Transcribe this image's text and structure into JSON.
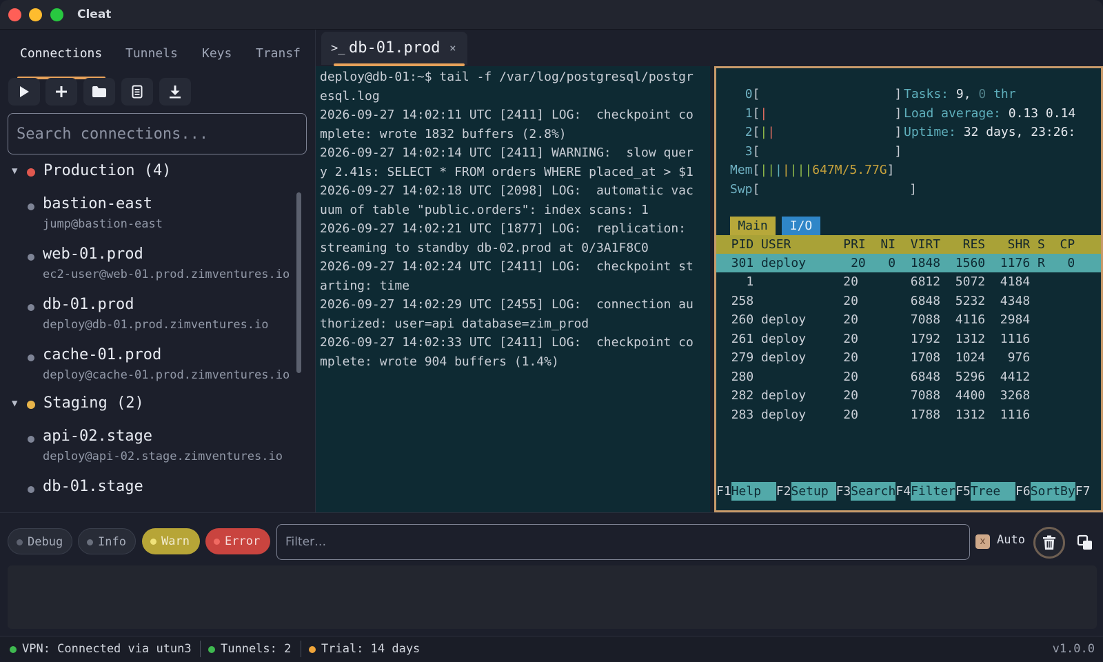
{
  "app": {
    "title": "Cleat"
  },
  "sidebar": {
    "tabs": [
      {
        "label": "Connections"
      },
      {
        "label": "Tunnels"
      },
      {
        "label": "Keys"
      },
      {
        "label": "Transf"
      }
    ],
    "toolbar": [
      "play-icon",
      "plus-icon",
      "folder-icon",
      "document-icon",
      "download-icon"
    ],
    "search_placeholder": "Search connections...",
    "groups": [
      {
        "label": "Production (4)",
        "color": "#e0584f",
        "hosts": [
          {
            "name": "bastion-east",
            "sub": "jump@bastion-east"
          },
          {
            "name": "web-01.prod",
            "sub": "ec2-user@web-01.prod.zimventures.io"
          },
          {
            "name": "db-01.prod",
            "sub": "deploy@db-01.prod.zimventures.io"
          },
          {
            "name": "cache-01.prod",
            "sub": "deploy@cache-01.prod.zimventures.io"
          }
        ]
      },
      {
        "label": "Staging (2)",
        "color": "#e8b44a",
        "hosts": [
          {
            "name": "api-02.stage",
            "sub": "deploy@api-02.stage.zimventures.io"
          },
          {
            "name": "db-01.stage",
            "sub": ""
          }
        ]
      }
    ]
  },
  "terminal": {
    "tab_label": "db-01.prod",
    "tab_icon": ">_",
    "close": "×",
    "log_lines": [
      "deploy@db-01:~$ tail -f /var/log/postgresql/postgr",
      "esql.log",
      "2026-09-27 14:02:11 UTC [2411] LOG:  checkpoint co",
      "mplete: wrote 1832 buffers (2.8%)",
      "2026-09-27 14:02:14 UTC [2411] WARNING:  slow quer",
      "y 2.41s: SELECT * FROM orders WHERE placed_at > $1",
      "2026-09-27 14:02:18 UTC [2098] LOG:  automatic vac",
      "uum of table \"public.orders\": index scans: 1",
      "2026-09-27 14:02:21 UTC [1877] LOG:  replication:",
      "streaming to standby db-02.prod at 0/3A1F8C0",
      "2026-09-27 14:02:24 UTC [2411] LOG:  checkpoint st",
      "arting: time",
      "2026-09-27 14:02:29 UTC [2455] LOG:  connection au",
      "thorized: user=api database=zim_prod",
      "2026-09-27 14:02:33 UTC [2411] LOG:  checkpoint co",
      "mplete: wrote 904 buffers (1.4%)"
    ]
  },
  "htop": {
    "cpus": [
      "0",
      "1",
      "2",
      "3"
    ],
    "tasks_label": "Tasks:",
    "tasks_value": "9,",
    "threads_value": "0",
    "threads_label": "thr",
    "load_label": "Load average:",
    "load_value": "0.13 0.14",
    "uptime_label": "Uptime:",
    "uptime_value": "32 days, 23:26:",
    "mem_label": "Mem",
    "mem_value": "647M/5.77G",
    "swp_label": "Swp",
    "tabs": [
      "Main",
      "I/O"
    ],
    "header": "  PID USER       PRI  NI  VIRT   RES   SHR S  CP",
    "selected_row": "  301 deploy      20   0  1848  1560  1176 R   0",
    "rows": [
      "    1            20       6812  5072  4184",
      "  258            20       6848  5232  4348",
      "  260 deploy     20       7088  4116  2984",
      "  261 deploy     20       1792  1312  1116",
      "  279 deploy     20       1708  1024   976",
      "  280            20       6848  5296  4412",
      "  282 deploy     20       7088  4400  3268",
      "  283 deploy     20       1788  1312  1116"
    ],
    "fkeys": [
      {
        "num": "F1",
        "label": "Help  "
      },
      {
        "num": "F2",
        "label": "Setup "
      },
      {
        "num": "F3",
        "label": "Search"
      },
      {
        "num": "F4",
        "label": "Filter"
      },
      {
        "num": "F5",
        "label": "Tree  "
      },
      {
        "num": "F6",
        "label": "SortBy"
      },
      {
        "num": "F7",
        "label": ""
      }
    ]
  },
  "logbar": {
    "levels": [
      {
        "label": "Debug",
        "dot": "#5d6270"
      },
      {
        "label": "Info",
        "dot": "#6a707d"
      },
      {
        "label": "Warn",
        "dot": "#f0e27a"
      },
      {
        "label": "Error",
        "dot": "#f06a62"
      }
    ],
    "filter_placeholder": "Filter…",
    "auto_label": "Auto",
    "auto_check": "x"
  },
  "status": {
    "vpn": "VPN: Connected via utun3",
    "tunnels": "Tunnels: 2",
    "trial": "Trial: 14 days",
    "version": "v1.0.0"
  }
}
